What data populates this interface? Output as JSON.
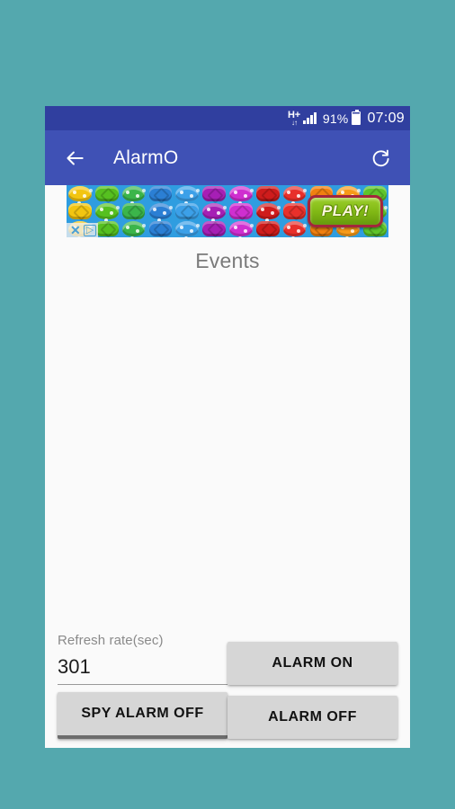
{
  "background_color": "#54a8ae",
  "status_bar": {
    "network_type": "H+",
    "network_arrows": "↓↑",
    "signal_icon": "signal-bars-icon",
    "battery_percent": "91%",
    "battery_icon": "battery-icon",
    "clock": "07:09",
    "background_color": "#303f9f"
  },
  "app_bar": {
    "back_icon": "back-arrow-icon",
    "title": "AlarmO",
    "refresh_icon": "refresh-icon",
    "background_color": "#3f51b5"
  },
  "ad": {
    "play_label": "PLAY!",
    "close_glyph": "✕",
    "info_glyph": "▷",
    "tile_colors": [
      [
        "#f2c511",
        "#f2c511",
        "#f2c511"
      ],
      [
        "#56c020",
        "#56c020",
        "#56c020"
      ],
      [
        "#3bb54a",
        "#3bb54a",
        "#3bb54a"
      ],
      [
        "#2b7fd4",
        "#2b7fd4",
        "#2b7fd4"
      ],
      [
        "#3ca0e8",
        "#3ca0e8",
        "#3ca0e8"
      ],
      [
        "#a61fb5",
        "#a61fb5",
        "#a61fb5"
      ],
      [
        "#cf2fd0",
        "#cf2fd0",
        "#cf2fd0"
      ],
      [
        "#cf1c1c",
        "#cf1c1c",
        "#cf1c1c"
      ],
      [
        "#e8302b",
        "#e8302b",
        "#e8302b"
      ],
      [
        "#f08010",
        "#f08010",
        "#f08010"
      ],
      [
        "#f79a18",
        "#f79a18",
        "#f79a18"
      ],
      [
        "#5ec42b",
        "#5ec42b",
        "#5ec42b"
      ]
    ]
  },
  "content": {
    "events_title": "Events"
  },
  "controls": {
    "refresh_rate_label": "Refresh rate(sec)",
    "refresh_rate_value": "301",
    "refresh_rate_placeholder": "",
    "alarm_on_label": "ALARM ON",
    "alarm_off_label": "ALARM OFF",
    "spy_alarm_off_label": "SPY ALARM OFF",
    "button_color": "#d6d6d6"
  }
}
